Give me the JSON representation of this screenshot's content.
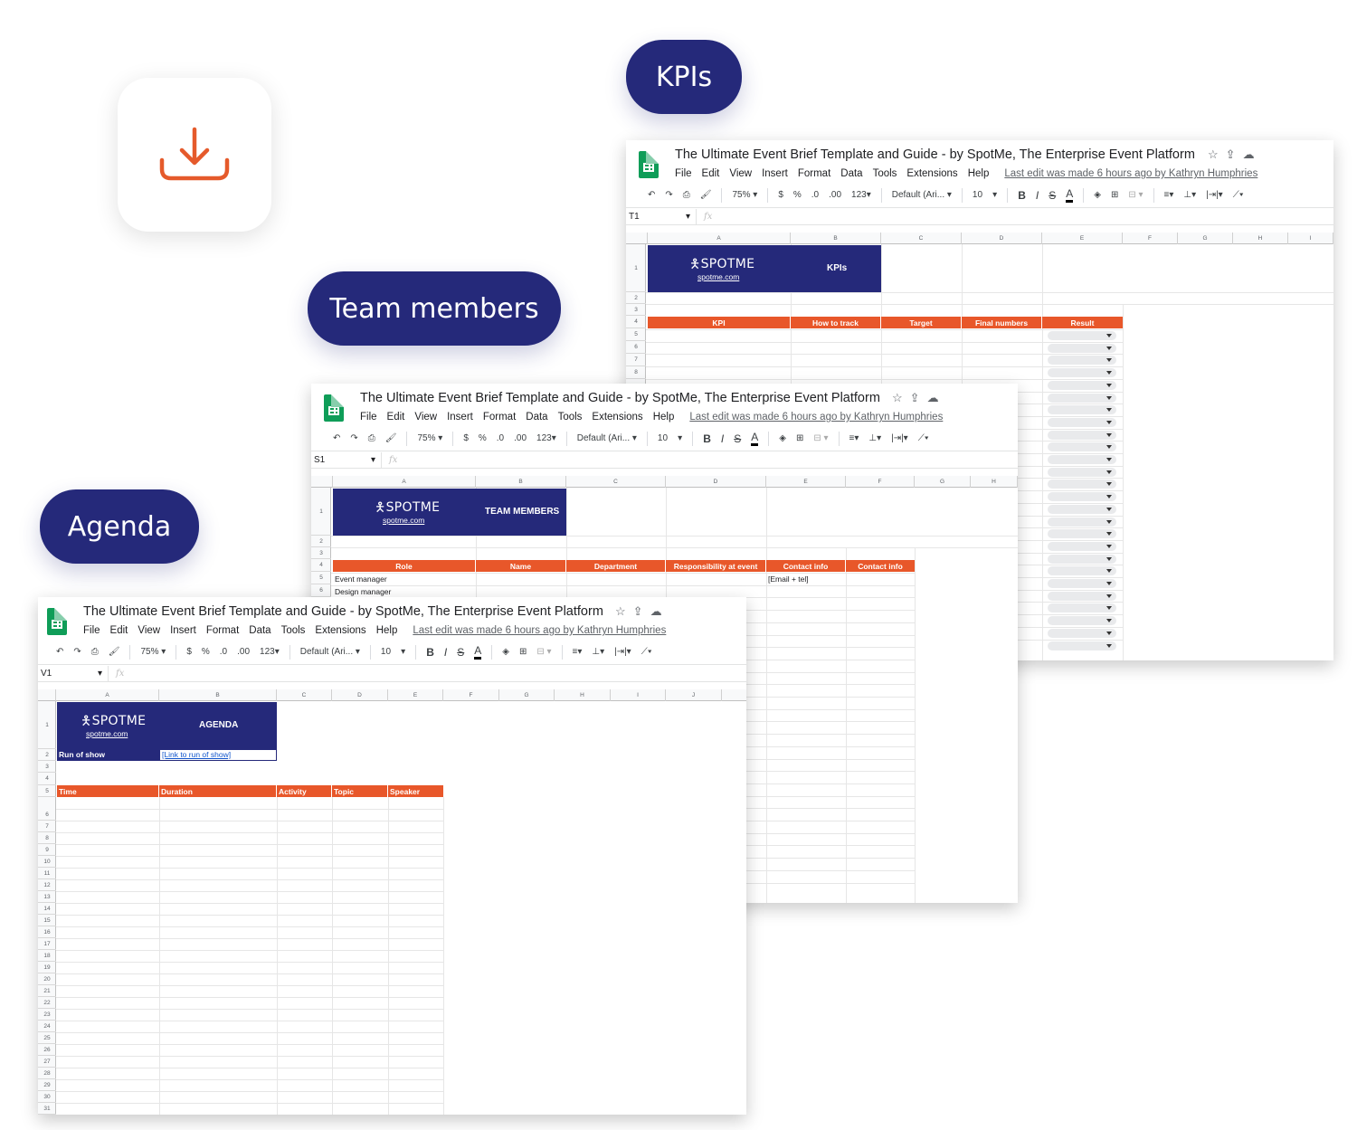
{
  "labels": {
    "kpis": "KPIs",
    "team": "Team members",
    "agenda": "Agenda"
  },
  "colors": {
    "navy": "#25297a",
    "orange": "#e8572a",
    "download_icon": "#e55a2b"
  },
  "icons": {
    "download": "download-icon",
    "star": "star-icon",
    "drive_move": "move-to-drive-icon",
    "cloud": "cloud-status-icon"
  },
  "sheet": {
    "title": "The Ultimate Event Brief Template and Guide - by SpotMe, The Enterprise Event Platform",
    "menu": [
      "File",
      "Edit",
      "View",
      "Insert",
      "Format",
      "Data",
      "Tools",
      "Extensions",
      "Help"
    ],
    "last_edit": "Last edit was made 6 hours ago by Kathryn Humphries",
    "toolbar": {
      "zoom": "75%",
      "currency": "$",
      "percent": "%",
      "dec_less": ".0",
      "dec_more": ".00",
      "format": "123",
      "font": "Default (Ari...",
      "size": "10",
      "bold": "B",
      "italic": "I",
      "strike": "S",
      "text_color": "A"
    },
    "fx": "fx",
    "brand": "SPOTME",
    "brand_link": "spotme.com"
  },
  "kpi": {
    "cell_ref": "T1",
    "columns": [
      "A",
      "B",
      "C",
      "D",
      "E",
      "F",
      "G",
      "H",
      "I"
    ],
    "banner_title": "KPIs",
    "headers": [
      "KPI",
      "How to track",
      "Target",
      "Final numbers",
      "Result"
    ]
  },
  "team": {
    "cell_ref": "S1",
    "columns": [
      "A",
      "B",
      "C",
      "D",
      "E",
      "F",
      "G",
      "H"
    ],
    "banner_title": "TEAM MEMBERS",
    "headers": [
      "Role",
      "Name",
      "Department",
      "Responsibility at event",
      "Contact info",
      "Contact info"
    ],
    "rows": [
      [
        "Event manager",
        "[Email + tel]"
      ],
      [
        "Design manager",
        ""
      ]
    ]
  },
  "agenda": {
    "cell_ref": "V1",
    "columns": [
      "A",
      "B",
      "C",
      "D",
      "E",
      "F",
      "G",
      "H",
      "I",
      "J"
    ],
    "banner_title": "AGENDA",
    "run_of_show_label": "Run of show",
    "run_of_show_link": "[Link to run of show]",
    "headers": [
      "Time",
      "Duration",
      "Activity",
      "Topic",
      "Speaker"
    ]
  }
}
